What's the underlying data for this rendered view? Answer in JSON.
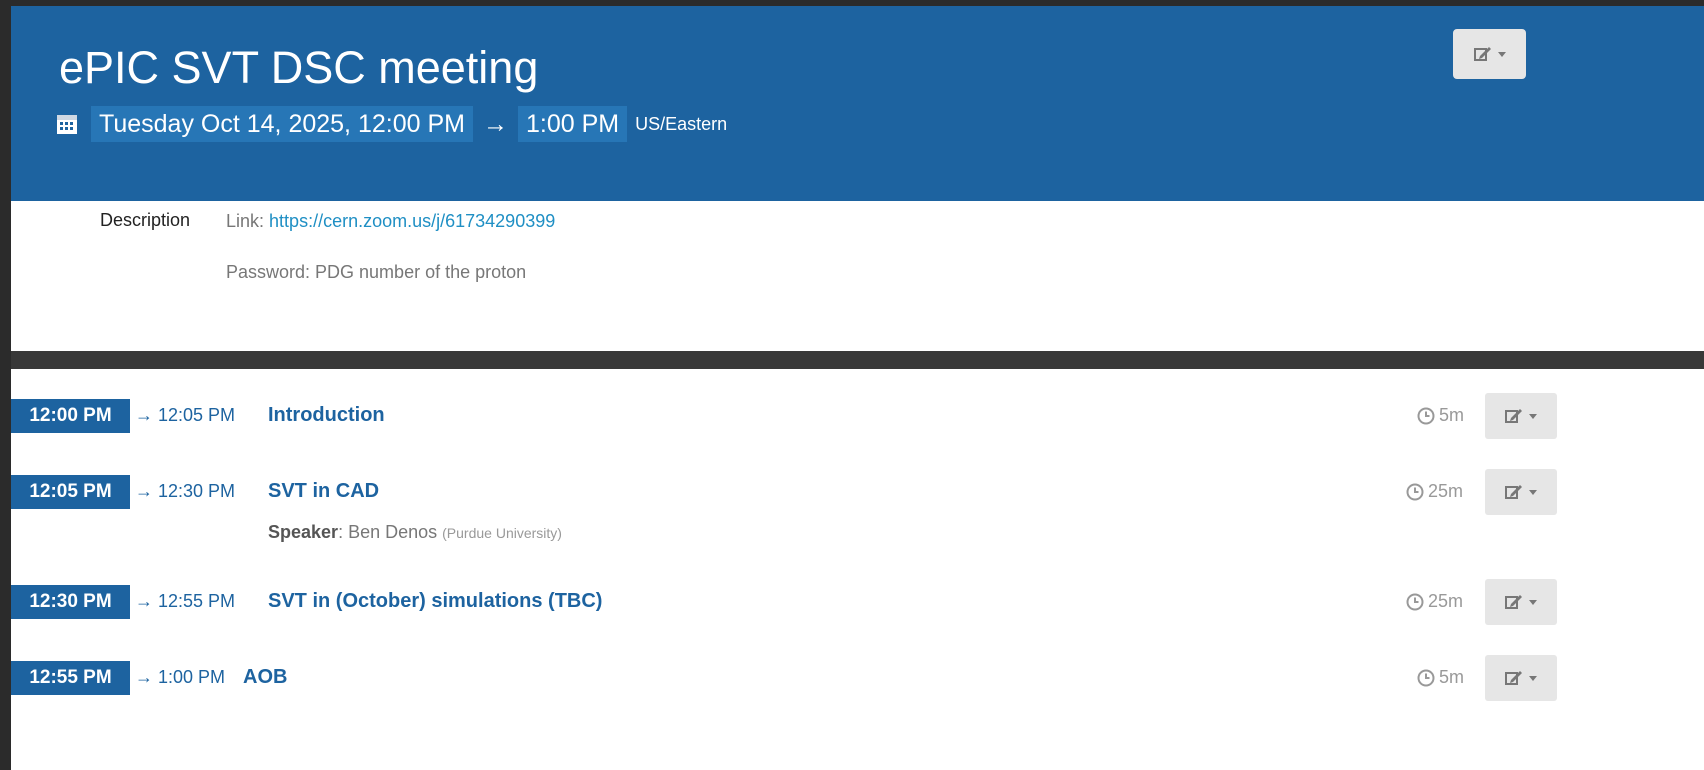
{
  "event": {
    "title": "ePIC SVT DSC meeting",
    "date_start": "Tuesday Oct 14, 2025, 12:00 PM",
    "arrow": "→",
    "time_end": "1:00 PM",
    "timezone": "US/Eastern"
  },
  "description": {
    "label": "Description",
    "link_prefix": "Link:",
    "link_url": "https://cern.zoom.us/j/61734290399",
    "password_line": "Password: PDG number of the proton"
  },
  "timetable": [
    {
      "start": "12:00 PM",
      "end": "→ 12:05 PM",
      "title": "Introduction",
      "duration": "5m"
    },
    {
      "start": "12:05 PM",
      "end": "→ 12:30 PM",
      "title": "SVT in CAD",
      "duration": "25m",
      "speaker_label": "Speaker",
      "speaker_name": ": Ben Denos",
      "speaker_affiliation": "(Purdue University)"
    },
    {
      "start": "12:30 PM",
      "end": "→ 12:55 PM",
      "title": "SVT in (October) simulations (TBC)",
      "duration": "25m"
    },
    {
      "start": "12:55 PM",
      "end": "→ 1:00 PM",
      "title": "AOB",
      "duration": "5m"
    }
  ],
  "icons": {
    "calendar": "calendar-icon",
    "clock": "clock-icon",
    "edit": "edit-icon"
  },
  "colors": {
    "header_bg": "#1d63a0",
    "time_box": "#2776b6",
    "link": "#1f8fc4"
  }
}
